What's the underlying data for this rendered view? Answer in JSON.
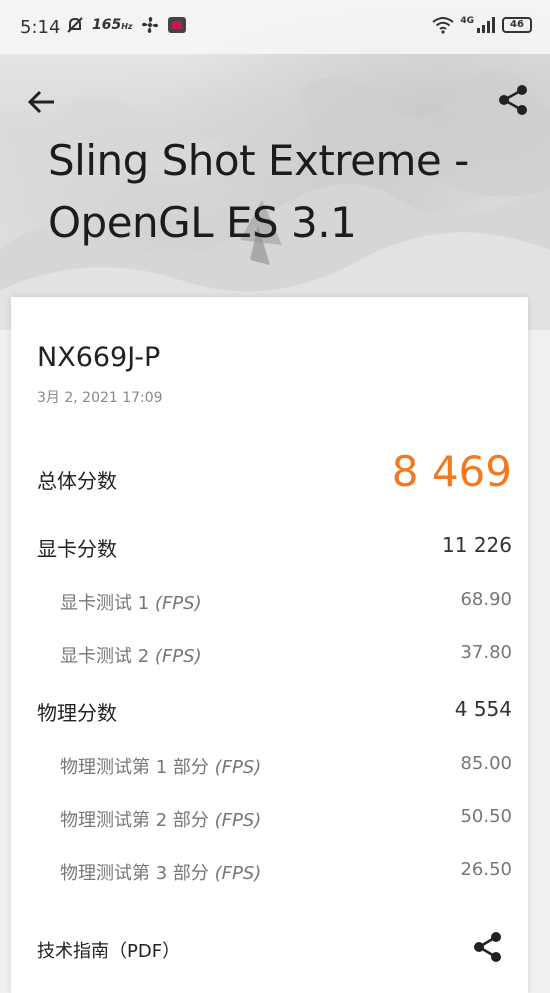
{
  "status_bar": {
    "time": "5:14",
    "refresh_rate": "165",
    "refresh_unit": "Hz",
    "network": "4G",
    "battery": "46"
  },
  "header": {
    "title": "Sling Shot Extreme - OpenGL ES 3.1"
  },
  "result": {
    "device": "NX669J-P",
    "date": "3月 2, 2021 17:09",
    "rows": [
      {
        "label": "总体分数",
        "value": "8 469"
      },
      {
        "label": "显卡分数",
        "value": "11 226"
      },
      {
        "label": "显卡测试 1",
        "fps": "(FPS)",
        "value": "68.90"
      },
      {
        "label": "显卡测试 2",
        "fps": "(FPS)",
        "value": "37.80"
      },
      {
        "label": "物理分数",
        "value": "4 554"
      },
      {
        "label": "物理测试第 1 部分",
        "fps": "(FPS)",
        "value": "85.00"
      },
      {
        "label": "物理测试第 2 部分",
        "fps": "(FPS)",
        "value": "50.50"
      },
      {
        "label": "物理测试第 3 部分",
        "fps": "(FPS)",
        "value": "26.50"
      }
    ],
    "tech_guide_label": "技术指南（PDF）"
  },
  "colors": {
    "accent": "#f07a1f"
  }
}
